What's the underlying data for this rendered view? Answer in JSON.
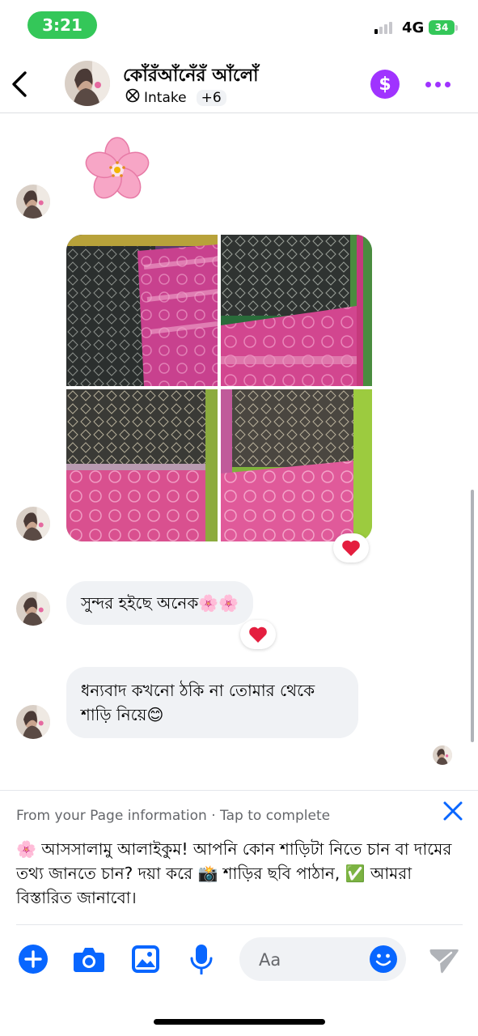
{
  "status_bar": {
    "time": "3:21",
    "network": "4G",
    "battery": "34"
  },
  "header": {
    "title": "কোঁরঁআঁনেঁরঁ আঁলোঁ",
    "label": "Intake",
    "extra_count": "+6",
    "pay_symbol": "$"
  },
  "messages": {
    "text1": "সুন্দর হইছে অনেক🌸🌸",
    "text2": "ধন্যবাদ কখনো ঠকি না তোমার থেকে শাড়ি নিয়ে😊"
  },
  "info_panel": {
    "hint": "From your Page information · Tap to complete",
    "text": "🌸 আসসালামু আলাইকুম! আপনি কোন শাড়িটা নিতে চান বা দামের তথ্য জানতে চান? দয়া করে 📸 শাড়ির ছবি পাঠান, ✅ আমরা বিস্তারিত জানাবো।"
  },
  "composer": {
    "placeholder": "Aa"
  },
  "colors": {
    "accent": "#0866ff",
    "purple": "#a033ff",
    "status_green": "#34c759",
    "heart": "#e41e3f"
  },
  "icons": [
    "back-chevron-icon",
    "dollar-icon",
    "more-dots-icon",
    "intake-icon",
    "cherry-blossom-icon",
    "heart-icon",
    "close-icon",
    "add-icon",
    "camera-icon",
    "gallery-icon",
    "microphone-icon",
    "emoji-icon",
    "send-icon"
  ]
}
